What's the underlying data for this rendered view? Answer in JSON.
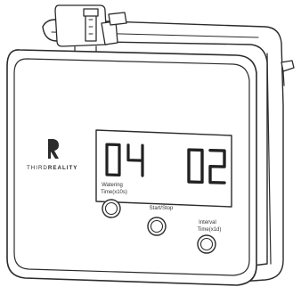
{
  "brand": {
    "prefix": "THIRD",
    "suffix": "REALITY",
    "logo_icon": "r-monogram-icon"
  },
  "display": {
    "left_value": "04",
    "right_value": "02"
  },
  "buttons": {
    "watering": {
      "line1": "Watering",
      "line2": "Time(x10s)"
    },
    "start_stop": {
      "label": "Start/Stop"
    },
    "interval": {
      "line1": "Interval",
      "line2": "Time(x1d)"
    }
  }
}
